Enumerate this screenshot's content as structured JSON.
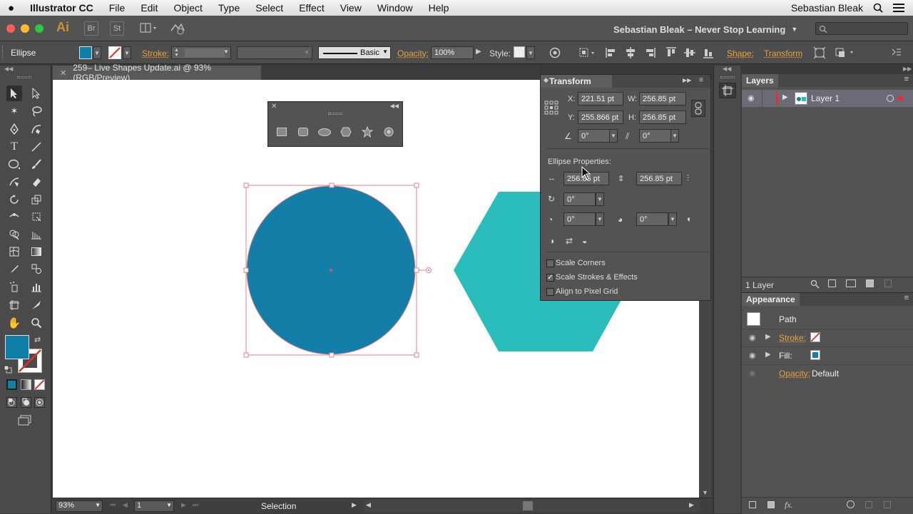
{
  "menubar": {
    "apple": "",
    "app_name": "Illustrator CC",
    "items": [
      "File",
      "Edit",
      "Object",
      "Type",
      "Select",
      "Effect",
      "View",
      "Window",
      "Help"
    ],
    "user": "Sebastian Bleak"
  },
  "appbar": {
    "logo": "Ai",
    "bridge": "Br",
    "stock": "St",
    "workspace": "Sebastian Bleak – Never Stop Learning"
  },
  "control": {
    "object_type": "Ellipse",
    "stroke_label": "Stroke:",
    "brush_label": "Basic",
    "opacity_label": "Opacity:",
    "opacity_value": "100%",
    "style_label": "Style:",
    "shape_label": "Shape:",
    "transform_label": "Transform",
    "fill_color": "#1180a8"
  },
  "document": {
    "tab_title": "259– Live Shapes Update.ai @ 93% (RGB/Preview)",
    "circle_color": "#137ea7",
    "hexagon_color": "#2bbdbc"
  },
  "transform_panel": {
    "title": "Transform",
    "x_label": "X:",
    "x_value": "221.51 pt",
    "y_label": "Y:",
    "y_value": "255.866 pt",
    "w_label": "W:",
    "w_value": "256.85 pt",
    "h_label": "H:",
    "h_value": "256.85 pt",
    "rotate_value": "0°",
    "shear_value": "0°",
    "ellipse_props_label": "Ellipse Properties:",
    "ellipse_width_value": "256.85 pt",
    "ellipse_height_value": "256.85 pt",
    "ellipse_angle_value": "0°",
    "pie_start_value": "0°",
    "pie_end_value": "0°",
    "scale_corners_label": "Scale Corners",
    "scale_corners_checked": false,
    "scale_strokes_label": "Scale Strokes & Effects",
    "scale_strokes_checked": true,
    "align_pixel_label": "Align to Pixel Grid",
    "align_pixel_checked": false
  },
  "layers_panel": {
    "title": "Layers",
    "layer_name": "Layer 1",
    "count_label": "1 Layer"
  },
  "appearance_panel": {
    "title": "Appearance",
    "path_label": "Path",
    "stroke_label": "Stroke:",
    "fill_label": "Fill:",
    "opacity_label": "Opacity:",
    "opacity_value": "Default"
  },
  "statusbar": {
    "zoom": "93%",
    "artboard": "1",
    "tool_name": "Selection"
  }
}
